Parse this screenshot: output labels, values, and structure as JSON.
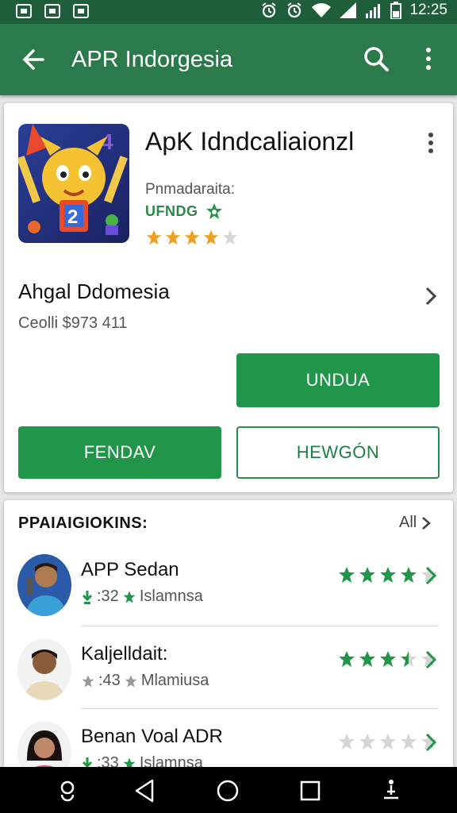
{
  "status_bar": {
    "time": "12:25"
  },
  "app_bar": {
    "title": "APR Indorgesia"
  },
  "app": {
    "name": "ApK Idndcaliaionzl",
    "developer": "Pnmadaraita:",
    "badge": "UFNDG",
    "rating_stars": 4,
    "section_title": "Ahgal Ddomesia",
    "section_subtitle": "Ceolli $973 411",
    "install_button": "UNDUA",
    "left_button": "FENDAV",
    "right_button": "HEWGÓN"
  },
  "reviews": {
    "header": "PPAIAIGIOKINS:",
    "all_label": "All",
    "items": [
      {
        "name": "APP Sedan",
        "count": ":32",
        "sub": "Islamnsa",
        "stars": 4
      },
      {
        "name": "Kaljelldait:",
        "count": ":43",
        "sub": "Mlamiusa",
        "stars": 3.5
      },
      {
        "name": "Benan Voal ADR",
        "count": ":33",
        "sub": "Islamnsa",
        "stars": 0
      }
    ]
  },
  "colors": {
    "status_bar": "#1e5e3a",
    "app_bar": "#2a7a4b",
    "primary_green": "#21964a",
    "star_orange": "#f0a020",
    "star_green": "#21964a"
  }
}
